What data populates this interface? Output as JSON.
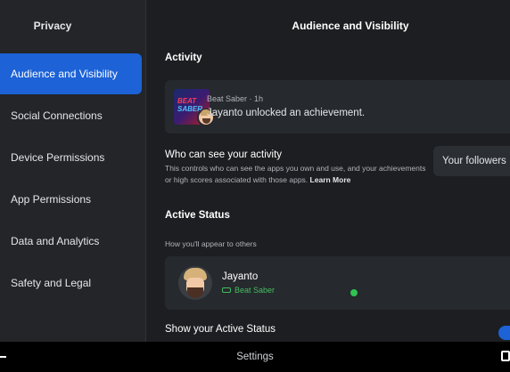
{
  "sidebar": {
    "title": "Privacy",
    "items": [
      {
        "label": "Audience and Visibility",
        "active": true
      },
      {
        "label": "Social Connections"
      },
      {
        "label": "Device Permissions"
      },
      {
        "label": "App Permissions"
      },
      {
        "label": "Data and Analytics"
      },
      {
        "label": "Safety and Legal"
      }
    ]
  },
  "main": {
    "header": "Audience and Visibility",
    "activity": {
      "section_title": "Activity",
      "game_logo_line1": "BEAT",
      "game_logo_line2": "SABER",
      "meta": "Beat Saber · 1h",
      "text": "Jayanto unlocked an achievement."
    },
    "who_can_see": {
      "title": "Who can see your activity",
      "description": "This controls who can see the apps you own and use, and your achievements or high scores associated with those apps.",
      "learn_more": "Learn More",
      "selected": "Your followers"
    },
    "active_status": {
      "section_title": "Active Status",
      "hint": "How you'll appear to others",
      "name": "Jayanto",
      "game": "Beat Saber",
      "online": true
    },
    "show_active": {
      "title": "Show your Active Status",
      "enabled": true
    }
  },
  "bottom_bar": {
    "label": "Settings"
  },
  "colors": {
    "accent": "#1d62d6",
    "online": "#31c451",
    "background": "#1c1e21",
    "sidebar": "#232528"
  }
}
